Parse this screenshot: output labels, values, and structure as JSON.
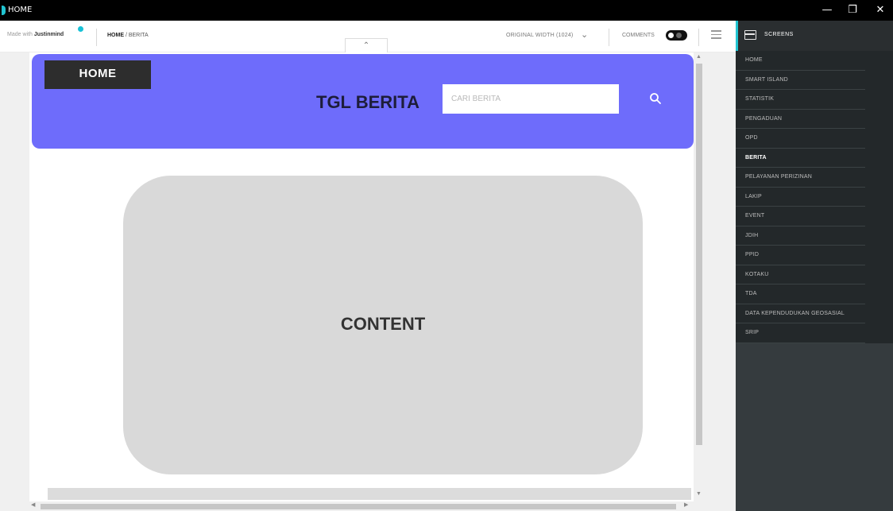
{
  "window": {
    "title": "HOME",
    "minimize": "—",
    "restore": "❐",
    "close": "✕"
  },
  "toolbar": {
    "made_with_prefix": "Made with",
    "made_with_brand": "Justinmind",
    "breadcrumb_current": "HOME",
    "breadcrumb_sep": " / ",
    "breadcrumb_page": "BERITA",
    "width_option": "ORIGINAL WIDTH (1024)",
    "comments_label": "COMMENTS",
    "comments_enabled": true
  },
  "page": {
    "home_button": "HOME",
    "hero_title": "TGL BERITA",
    "search_placeholder": "CARI BERITA",
    "content_label": "CONTENT",
    "hero_color": "#6e6cfb"
  },
  "sidebar": {
    "header": "SCREENS",
    "accent_color": "#21c4d1",
    "items": [
      {
        "label": "HOME",
        "active": false
      },
      {
        "label": "SMART ISLAND",
        "active": false
      },
      {
        "label": "STATISTIK",
        "active": false
      },
      {
        "label": "PENGADUAN",
        "active": false
      },
      {
        "label": "OPD",
        "active": false
      },
      {
        "label": "BERITA",
        "active": true
      },
      {
        "label": "PELAYANAN PERIZINAN",
        "active": false
      },
      {
        "label": "LAKIP",
        "active": false
      },
      {
        "label": "EVENT",
        "active": false
      },
      {
        "label": "JDIH",
        "active": false
      },
      {
        "label": "PPID",
        "active": false
      },
      {
        "label": "KOTAKU",
        "active": false
      },
      {
        "label": "TDA",
        "active": false
      },
      {
        "label": "DATA KEPENDUDUKAN GEOSASIAL",
        "active": false
      },
      {
        "label": "SRIP",
        "active": false
      }
    ]
  }
}
